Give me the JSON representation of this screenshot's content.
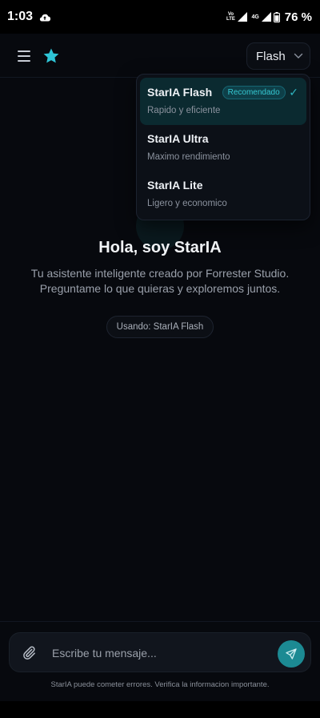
{
  "status_bar": {
    "time": "1:03",
    "volte": "Vo LTE",
    "network": "4G",
    "battery": "76 %",
    "icons": [
      "cloud-upload-icon",
      "signal-icon",
      "signal-icon",
      "battery-icon"
    ]
  },
  "header": {
    "menu_icon": "menu-icon",
    "favorite_icon": "star-icon",
    "model_label": "Flash",
    "chevron_icon": "chevron-down-icon"
  },
  "model_menu": {
    "options": [
      {
        "name": "StarIA Flash",
        "badge": "Recomendado",
        "description": "Rapido y eficiente",
        "selected": true,
        "check": "✓"
      },
      {
        "name": "StarIA Ultra",
        "description": "Maximo rendimiento",
        "selected": false
      },
      {
        "name": "StarIA Lite",
        "description": "Ligero y economico",
        "selected": false
      }
    ]
  },
  "hero": {
    "title": "Hola, soy StarIA",
    "subtitle": "Tu asistente inteligente creado por Forrester Studio. Preguntame lo que quieras y exploremos juntos.",
    "using_label": "Usando: StarIA Flash"
  },
  "composer": {
    "placeholder": "Escribe tu mensaje...",
    "value": "",
    "attach_icon": "paperclip-icon",
    "send_icon": "send-icon",
    "disclaimer": "StarIA puede cometer errores. Verifica la informacion importante."
  },
  "colors": {
    "accent": "#1c8a93",
    "accent_text": "#2fb6c1",
    "background": "#07090e",
    "star": "#2ec4d6"
  }
}
